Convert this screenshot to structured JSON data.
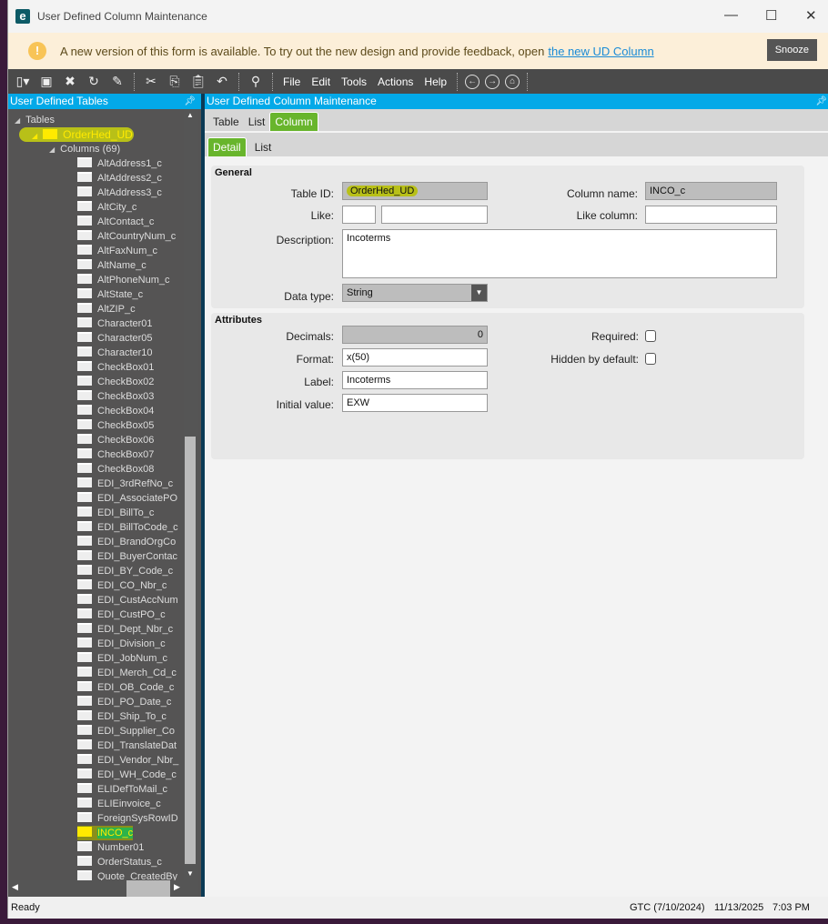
{
  "window": {
    "title": "User Defined Column Maintenance",
    "minimize": "—",
    "maximize": "☐",
    "close": "✕",
    "logo": "e"
  },
  "notice": {
    "text": "A new version of this form is available. To try out the new design and provide feedback, open",
    "link": "the new UD Column",
    "snooze": "Snooze"
  },
  "toolbar": {
    "menus": [
      "File",
      "Edit",
      "Tools",
      "Actions",
      "Help"
    ]
  },
  "left_panel": {
    "title": "User Defined Tables",
    "root": "Tables",
    "table": "OrderHed_UD",
    "columns_node": "Columns (69)",
    "columns": [
      "AltAddress1_c",
      "AltAddress2_c",
      "AltAddress3_c",
      "AltCity_c",
      "AltContact_c",
      "AltCountryNum_c",
      "AltFaxNum_c",
      "AltName_c",
      "AltPhoneNum_c",
      "AltState_c",
      "AltZIP_c",
      "Character01",
      "Character05",
      "Character10",
      "CheckBox01",
      "CheckBox02",
      "CheckBox03",
      "CheckBox04",
      "CheckBox05",
      "CheckBox06",
      "CheckBox07",
      "CheckBox08",
      "EDI_3rdRefNo_c",
      "EDI_AssociatePO",
      "EDI_BillTo_c",
      "EDI_BillToCode_c",
      "EDI_BrandOrgCo",
      "EDI_BuyerContac",
      "EDI_BY_Code_c",
      "EDI_CO_Nbr_c",
      "EDI_CustAccNum",
      "EDI_CustPO_c",
      "EDI_Dept_Nbr_c",
      "EDI_Division_c",
      "EDI_JobNum_c",
      "EDI_Merch_Cd_c",
      "EDI_OB_Code_c",
      "EDI_PO_Date_c",
      "EDI_Ship_To_c",
      "EDI_Supplier_Co",
      "EDI_TranslateDat",
      "EDI_Vendor_Nbr_",
      "EDI_WH_Code_c",
      "ELIDefToMail_c",
      "ELIEinvoice_c",
      "ForeignSysRowID",
      "INCO_c",
      "Number01",
      "OrderStatus_c",
      "Quote_CreatedBy"
    ],
    "selected": "INCO_c"
  },
  "right_panel": {
    "title": "User Defined Column Maintenance",
    "tabs": [
      "Table",
      "List",
      "Column"
    ],
    "subtabs": [
      "Detail",
      "List"
    ]
  },
  "general": {
    "title": "General",
    "table_id_label": "Table ID:",
    "table_id": "OrderHed_UD",
    "column_name_label": "Column name:",
    "column_name": "INCO_c",
    "like_label": "Like:",
    "like1": "",
    "like2": "",
    "like_column_label": "Like column:",
    "like_column": "",
    "description_label": "Description:",
    "description": "Incoterms",
    "data_type_label": "Data type:",
    "data_type": "String"
  },
  "attributes": {
    "title": "Attributes",
    "decimals_label": "Decimals:",
    "decimals": "0",
    "format_label": "Format:",
    "format": "x(50)",
    "label_label": "Label:",
    "label": "Incoterms",
    "initial_label": "Initial value:",
    "initial": "EXW",
    "required_label": "Required:",
    "hidden_label": "Hidden by default:"
  },
  "status": {
    "text": "Ready",
    "version": "GTC (7/10/2024)",
    "date": "11/13/2025",
    "time": "7:03 PM"
  },
  "colors": {
    "accent": "#03a9e8",
    "tab_active": "#68b52c",
    "highlight": "#b8c018"
  }
}
